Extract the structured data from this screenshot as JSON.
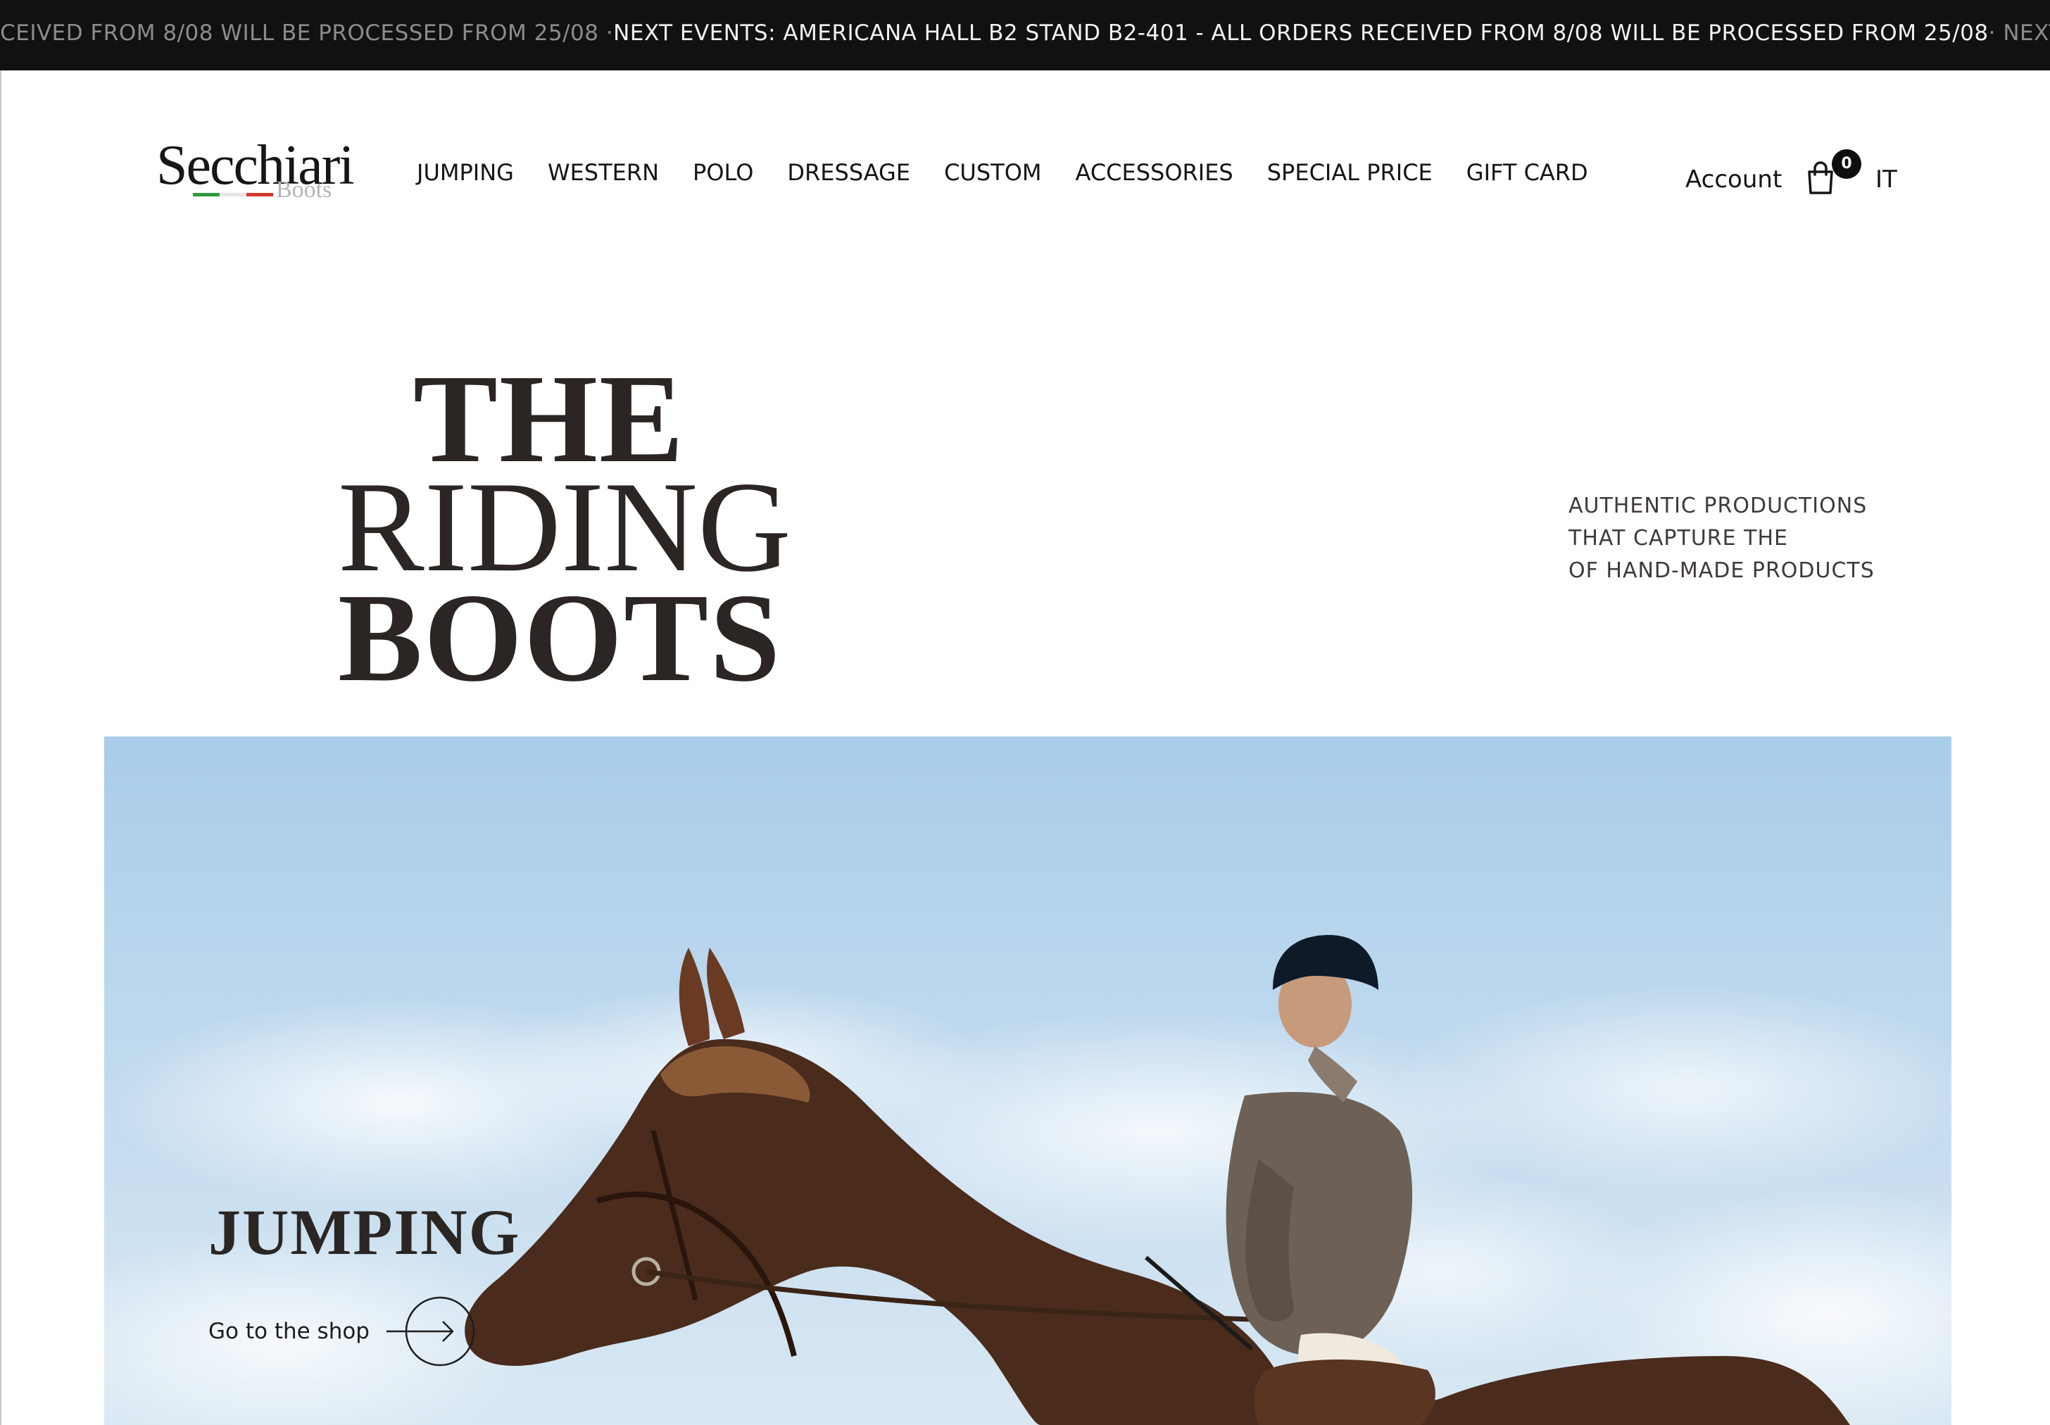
{
  "announcement": {
    "segment_dim_left": "ECEIVED FROM 8/08 WILL BE PROCESSED FROM 25/08 · ",
    "segment_bright": "NEXT EVENTS: AMERICANA HALL B2 STAND B2-401 - ALL ORDERS RECEIVED FROM 8/08 WILL BE PROCESSED FROM 25/08",
    "segment_dim_right": " · NEXT E"
  },
  "header": {
    "logo_main": "Secchiari",
    "logo_sub": "Boots",
    "flag_colors": [
      "#2e9a3f",
      "#f4f4f4",
      "#d23a2f"
    ],
    "nav": [
      "JUMPING",
      "WESTERN",
      "POLO",
      "DRESSAGE",
      "CUSTOM",
      "ACCESSORIES",
      "SPECIAL PRICE",
      "GIFT CARD"
    ],
    "account_label": "Account",
    "cart_icon": "shopping-bag-icon",
    "cart_count": "0",
    "language": "IT"
  },
  "hero": {
    "title_line1": "THE",
    "title_line2": "RIDING",
    "title_line3": "BOOTS",
    "tagline": [
      "AUTHENTIC PRODUCTIONS",
      "THAT CAPTURE THE",
      "OF HAND-MADE PRODUCTS"
    ]
  },
  "feature": {
    "title": "JUMPING",
    "link_label": "Go to the shop",
    "link_icon": "arrow-right-circle-icon"
  },
  "colors": {
    "announce_bg": "#111111",
    "text_dark": "#2b2623",
    "sky": "#8fc2e8"
  }
}
